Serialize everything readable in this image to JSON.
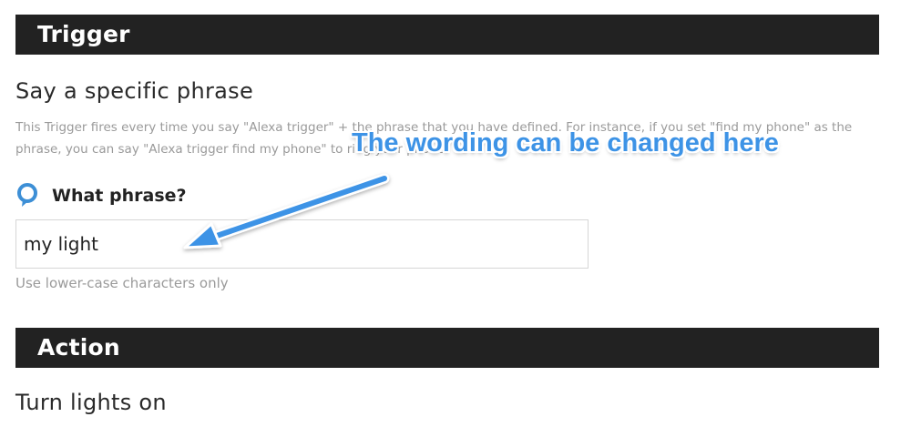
{
  "trigger": {
    "header": "Trigger",
    "title": "Say a specific phrase",
    "description": "This Trigger fires every time you say \"Alexa trigger\" + the phrase that you have defined. For instance, if you set \"find my phone\" as the phrase, you can say \"Alexa trigger find my phone\" to ring your phone.",
    "field": {
      "icon": "alexa-ring-icon",
      "label": "What phrase?",
      "value": "my light",
      "helper": "Use lower-case characters only"
    }
  },
  "action": {
    "header": "Action",
    "title": "Turn lights on"
  },
  "annotation": {
    "text": "The wording can be changed here",
    "color": "#3d93e6"
  },
  "colors": {
    "header_bg": "#222222",
    "muted_text": "#9a9a9a",
    "alexa_blue": "#3d8fd6"
  }
}
